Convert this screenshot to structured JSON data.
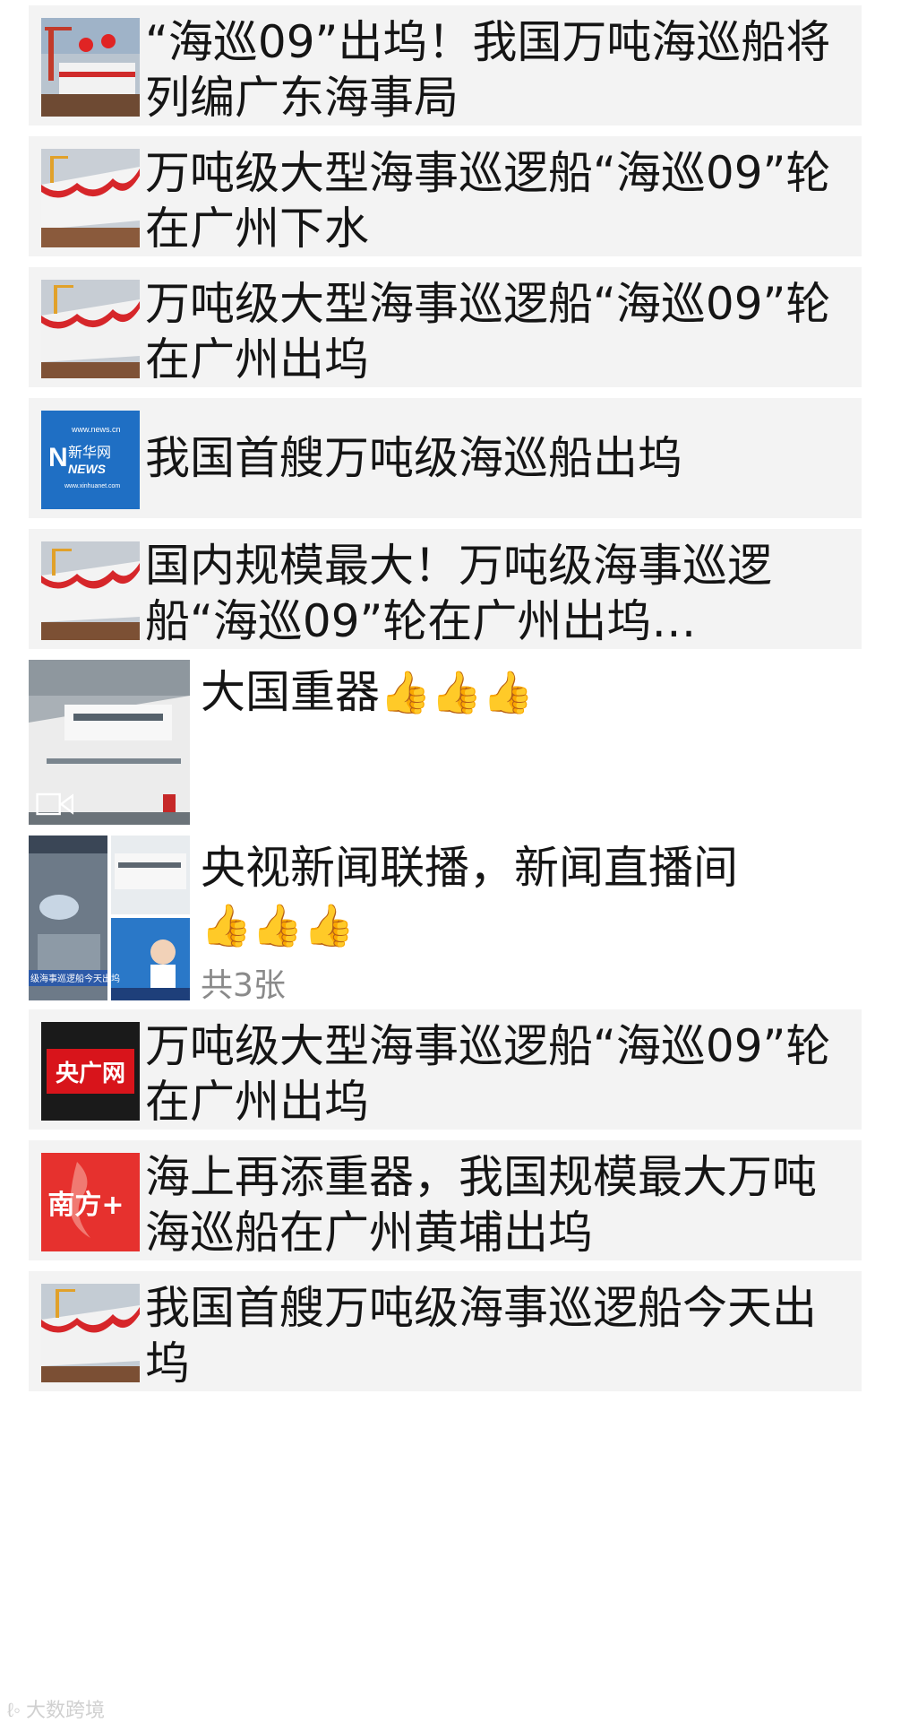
{
  "cards": [
    {
      "title": "“海巡09”出坞！我国万吨海巡船将列编广东海事局",
      "thumb": "ship-launch-photo"
    },
    {
      "title": "万吨级大型海事巡逻船“海巡09”轮在广州下水",
      "thumb": "ship-bow-photo"
    },
    {
      "title": "万吨级大型海事巡逻船“海巡09”轮在广州出坞",
      "thumb": "ship-bow-photo"
    },
    {
      "title": "我国首艘万吨级海巡船出坞",
      "thumb": "xinhua-news-logo",
      "logo_text": {
        "site": "www.news.cn",
        "brand": "新华网",
        "sub": "NEWS",
        "url": "www.xinhuanet.com"
      }
    },
    {
      "title": "国内规模最大！万吨级海事巡逻船“海巡09”轮在广州出坞…",
      "thumb": "ship-bow-photo"
    }
  ],
  "posts": [
    {
      "text": "大国重器",
      "emoji": "👍👍👍",
      "media": "ship-video-thumbnail",
      "icon": "video-icon"
    },
    {
      "text": "央视新闻联播，新闻直播间",
      "emoji": "👍👍👍",
      "media": "tv-news-collage",
      "count": "共3张",
      "tv_caption": "级海事巡逻船今天出坞"
    }
  ],
  "cards2": [
    {
      "title": "万吨级大型海事巡逻船“海巡09”轮在广州出坞",
      "thumb": "cnr-logo",
      "logo_text": "央广网"
    },
    {
      "title": "海上再添重器，我国规模最大万吨海巡船在广州黄埔出坞",
      "thumb": "nanfang-plus-logo",
      "logo_text": "南方+"
    },
    {
      "title": "我国首艘万吨级海事巡逻船今天出坞",
      "thumb": "ship-bow-photo"
    }
  ],
  "watermark": "大数跨境",
  "colors": {
    "card_bg": "#f3f3f3",
    "text": "#151515",
    "muted": "#8a8a8a",
    "xinhua_blue": "#1f6fc4",
    "cnr_red": "#d8141b",
    "nanfang_red": "#e6312e"
  }
}
